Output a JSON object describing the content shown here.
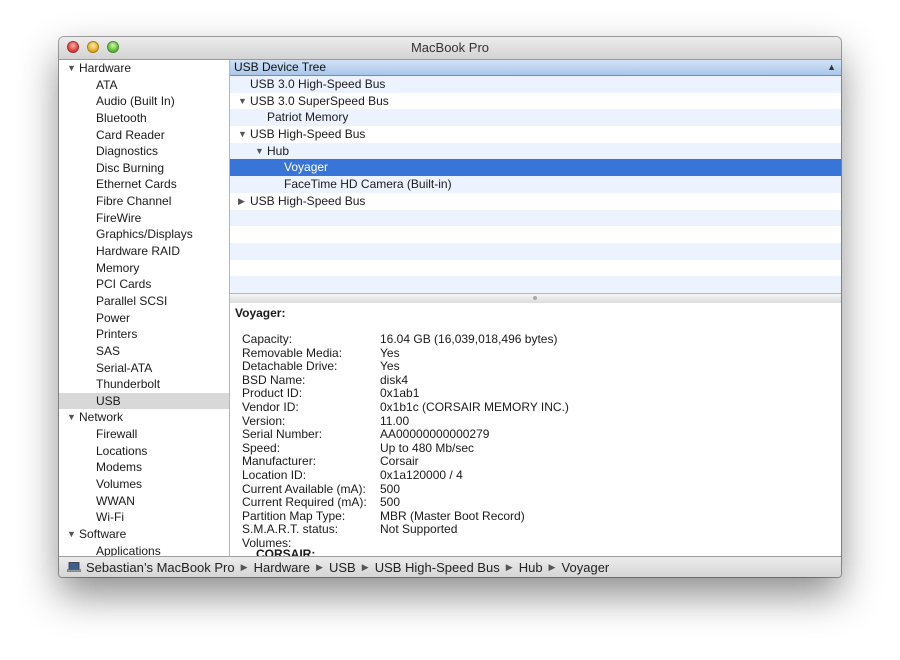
{
  "window": {
    "title": "MacBook Pro"
  },
  "sidebar": {
    "groups": [
      {
        "label": "Hardware",
        "expanded": true,
        "items": [
          {
            "label": "ATA"
          },
          {
            "label": "Audio (Built In)"
          },
          {
            "label": "Bluetooth"
          },
          {
            "label": "Card Reader"
          },
          {
            "label": "Diagnostics"
          },
          {
            "label": "Disc Burning"
          },
          {
            "label": "Ethernet Cards"
          },
          {
            "label": "Fibre Channel"
          },
          {
            "label": "FireWire"
          },
          {
            "label": "Graphics/Displays"
          },
          {
            "label": "Hardware RAID"
          },
          {
            "label": "Memory"
          },
          {
            "label": "PCI Cards"
          },
          {
            "label": "Parallel SCSI"
          },
          {
            "label": "Power"
          },
          {
            "label": "Printers"
          },
          {
            "label": "SAS"
          },
          {
            "label": "Serial-ATA"
          },
          {
            "label": "Thunderbolt"
          },
          {
            "label": "USB",
            "selected": true
          }
        ]
      },
      {
        "label": "Network",
        "expanded": true,
        "items": [
          {
            "label": "Firewall"
          },
          {
            "label": "Locations"
          },
          {
            "label": "Modems"
          },
          {
            "label": "Volumes"
          },
          {
            "label": "WWAN"
          },
          {
            "label": "Wi-Fi"
          }
        ]
      },
      {
        "label": "Software",
        "expanded": true,
        "items": [
          {
            "label": "Applications"
          }
        ]
      }
    ]
  },
  "tree": {
    "header": "USB Device Tree",
    "rows": [
      {
        "label": "USB 3.0 High-Speed Bus",
        "level": 0,
        "arrow": ""
      },
      {
        "label": "USB 3.0 SuperSpeed Bus",
        "level": 0,
        "arrow": "expanded"
      },
      {
        "label": "Patriot Memory",
        "level": 1,
        "arrow": ""
      },
      {
        "label": "USB High-Speed Bus",
        "level": 0,
        "arrow": "expanded"
      },
      {
        "label": "Hub",
        "level": 1,
        "arrow": "expanded"
      },
      {
        "label": "Voyager",
        "level": 2,
        "arrow": "",
        "selected": true
      },
      {
        "label": "FaceTime HD Camera (Built-in)",
        "level": 2,
        "arrow": ""
      },
      {
        "label": "USB High-Speed Bus",
        "level": 0,
        "arrow": "collapsed"
      },
      {
        "label": "",
        "level": 0,
        "arrow": ""
      },
      {
        "label": "",
        "level": 0,
        "arrow": ""
      },
      {
        "label": "",
        "level": 0,
        "arrow": ""
      },
      {
        "label": "",
        "level": 0,
        "arrow": ""
      },
      {
        "label": "",
        "level": 0,
        "arrow": ""
      }
    ]
  },
  "detail": {
    "title": "Voyager:",
    "properties": [
      {
        "key": "Capacity:",
        "value": "16.04 GB (16,039,018,496 bytes)"
      },
      {
        "key": "Removable Media:",
        "value": "Yes"
      },
      {
        "key": "Detachable Drive:",
        "value": "Yes"
      },
      {
        "key": "BSD Name:",
        "value": "disk4"
      },
      {
        "key": "Product ID:",
        "value": "0x1ab1"
      },
      {
        "key": "Vendor ID:",
        "value": "0x1b1c  (CORSAIR MEMORY INC.)"
      },
      {
        "key": "Version:",
        "value": "11.00"
      },
      {
        "key": "Serial Number:",
        "value": "AA00000000000279"
      },
      {
        "key": "Speed:",
        "value": "Up to 480 Mb/sec"
      },
      {
        "key": "Manufacturer:",
        "value": "Corsair"
      },
      {
        "key": "Location ID:",
        "value": "0x1a120000 / 4"
      },
      {
        "key": "Current Available (mA):",
        "value": "500"
      },
      {
        "key": "Current Required (mA):",
        "value": "500"
      },
      {
        "key": "Partition Map Type:",
        "value": "MBR (Master Boot Record)"
      },
      {
        "key": "S.M.A.R.T. status:",
        "value": "Not Supported"
      },
      {
        "key": "Volumes:",
        "value": ""
      }
    ],
    "volume_name": "CORSAIR:"
  },
  "pathbar": {
    "crumbs": [
      "Sebastian’s MacBook Pro",
      "Hardware",
      "USB",
      "USB High-Speed Bus",
      "Hub",
      "Voyager"
    ]
  }
}
